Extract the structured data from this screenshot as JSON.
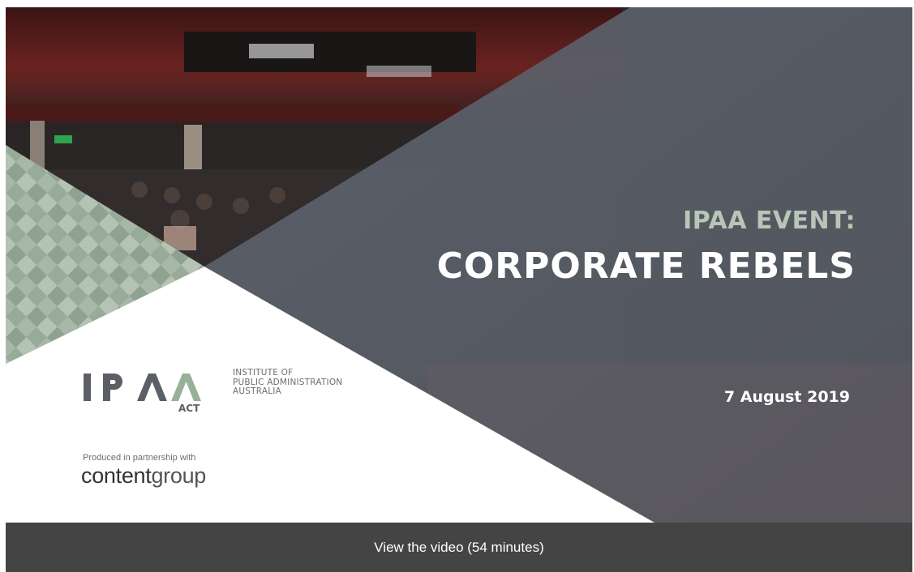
{
  "event": {
    "label": "IPAA EVENT:",
    "title": "CORPORATE REBELS",
    "date": "7 August 2019"
  },
  "organisation": {
    "wordmark": "IPAA",
    "sub": "ACT",
    "fullname_lines": [
      "INSTITUTE OF",
      "PUBLIC ADMINISTRATION",
      "AUSTRALIA"
    ]
  },
  "partner": {
    "note": "Produced in partnership with",
    "name_bold": "content",
    "name_light": "group"
  },
  "video_link": {
    "label": "View the video (54 minutes)"
  },
  "colors": {
    "overlay": "#4f545d",
    "accent_green": "#b7c6b7",
    "bar": "#444444"
  }
}
